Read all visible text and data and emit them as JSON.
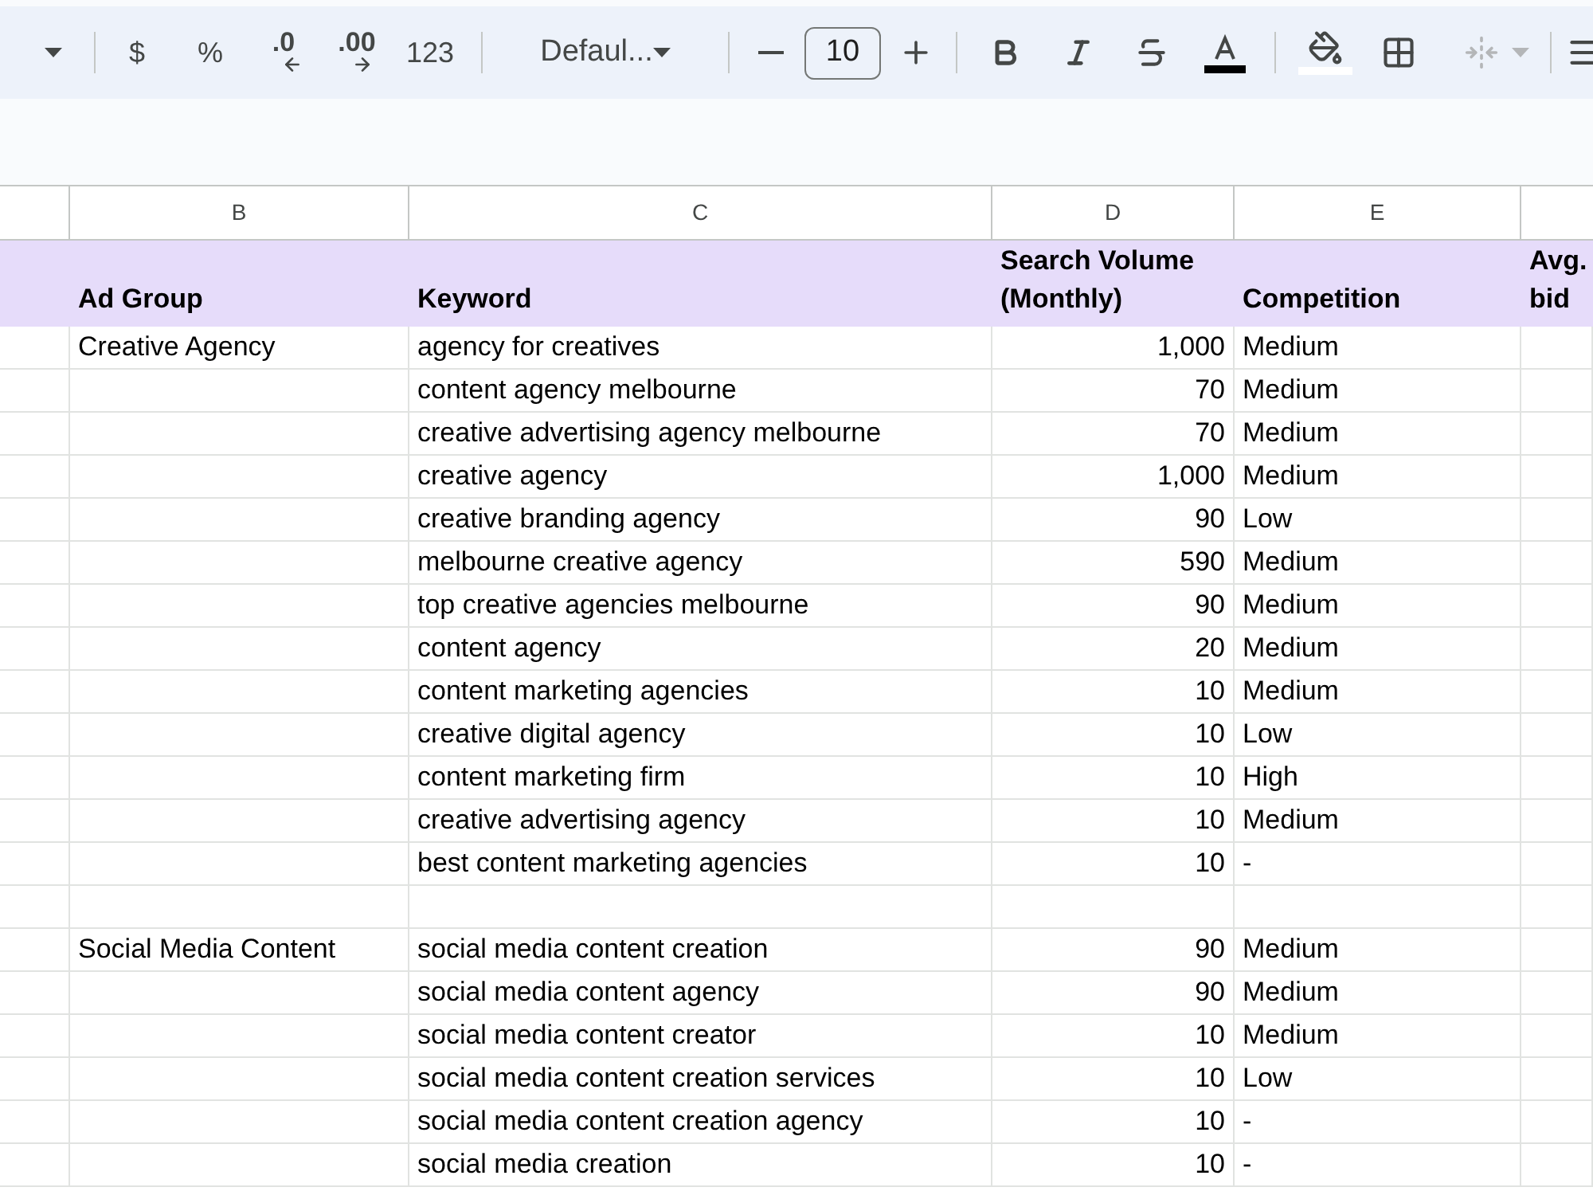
{
  "toolbar": {
    "groups": [
      {
        "items": [
          {
            "kind": "zoom-caret"
          }
        ]
      },
      {
        "items": [
          {
            "kind": "currency",
            "label": "$"
          },
          {
            "kind": "percent",
            "label": "%"
          },
          {
            "kind": "decrease-decimal",
            "label": ".0"
          },
          {
            "kind": "increase-decimal",
            "label": ".00"
          },
          {
            "kind": "number-format",
            "label": "123"
          }
        ]
      },
      {
        "items": [
          {
            "kind": "font",
            "label": "Defaul..."
          }
        ]
      },
      {
        "items": [
          {
            "kind": "minus"
          },
          {
            "kind": "font-size",
            "value": "10"
          },
          {
            "kind": "plus"
          }
        ]
      },
      {
        "items": [
          {
            "kind": "bold"
          },
          {
            "kind": "italic"
          },
          {
            "kind": "strikethrough"
          },
          {
            "kind": "text-color"
          }
        ]
      },
      {
        "items": [
          {
            "kind": "fill-color"
          },
          {
            "kind": "borders"
          },
          {
            "kind": "merge",
            "disabled": true
          }
        ]
      },
      {
        "items": [
          {
            "kind": "align"
          }
        ]
      }
    ]
  },
  "sheet": {
    "column_letters": [
      "B",
      "C",
      "D",
      "E"
    ],
    "header": {
      "ad_group": "Ad Group",
      "keyword": "Keyword",
      "search_volume": "Search Volume (Monthly)",
      "competition": "Competition",
      "column_6": "Avg. bid"
    },
    "rows": [
      {
        "ad_group": "Creative Agency",
        "keyword": "agency for creatives",
        "search_volume": "1,000",
        "competition": "Medium"
      },
      {
        "keyword": "content agency melbourne",
        "search_volume": "70",
        "competition": "Medium"
      },
      {
        "keyword": "creative advertising agency melbourne",
        "search_volume": "70",
        "competition": "Medium"
      },
      {
        "keyword": "creative agency",
        "search_volume": "1,000",
        "competition": "Medium"
      },
      {
        "keyword": "creative branding agency",
        "search_volume": "90",
        "competition": "Low"
      },
      {
        "keyword": "melbourne creative agency",
        "search_volume": "590",
        "competition": "Medium"
      },
      {
        "keyword": "top creative agencies melbourne",
        "search_volume": "90",
        "competition": "Medium"
      },
      {
        "keyword": "content agency",
        "search_volume": "20",
        "competition": "Medium"
      },
      {
        "keyword": "content marketing agencies",
        "search_volume": "10",
        "competition": "Medium"
      },
      {
        "keyword": "creative digital agency",
        "search_volume": "10",
        "competition": "Low"
      },
      {
        "keyword": "content marketing firm",
        "search_volume": "10",
        "competition": "High"
      },
      {
        "keyword": "creative advertising agency",
        "search_volume": "10",
        "competition": "Medium"
      },
      {
        "keyword": "best content marketing agencies",
        "search_volume": "10",
        "competition": "-"
      },
      {},
      {
        "ad_group": "Social Media Content",
        "keyword": "social media content creation",
        "search_volume": "90",
        "competition": "Medium"
      },
      {
        "keyword": "social media content agency",
        "search_volume": "90",
        "competition": "Medium"
      },
      {
        "keyword": "social media content creator",
        "search_volume": "10",
        "competition": "Medium"
      },
      {
        "keyword": "social media content creation services",
        "search_volume": "10",
        "competition": "Low"
      },
      {
        "keyword": "social media content creation agency",
        "search_volume": "10",
        "competition": "-"
      },
      {
        "keyword": "social media creation",
        "search_volume": "10",
        "competition": "-"
      }
    ]
  }
}
